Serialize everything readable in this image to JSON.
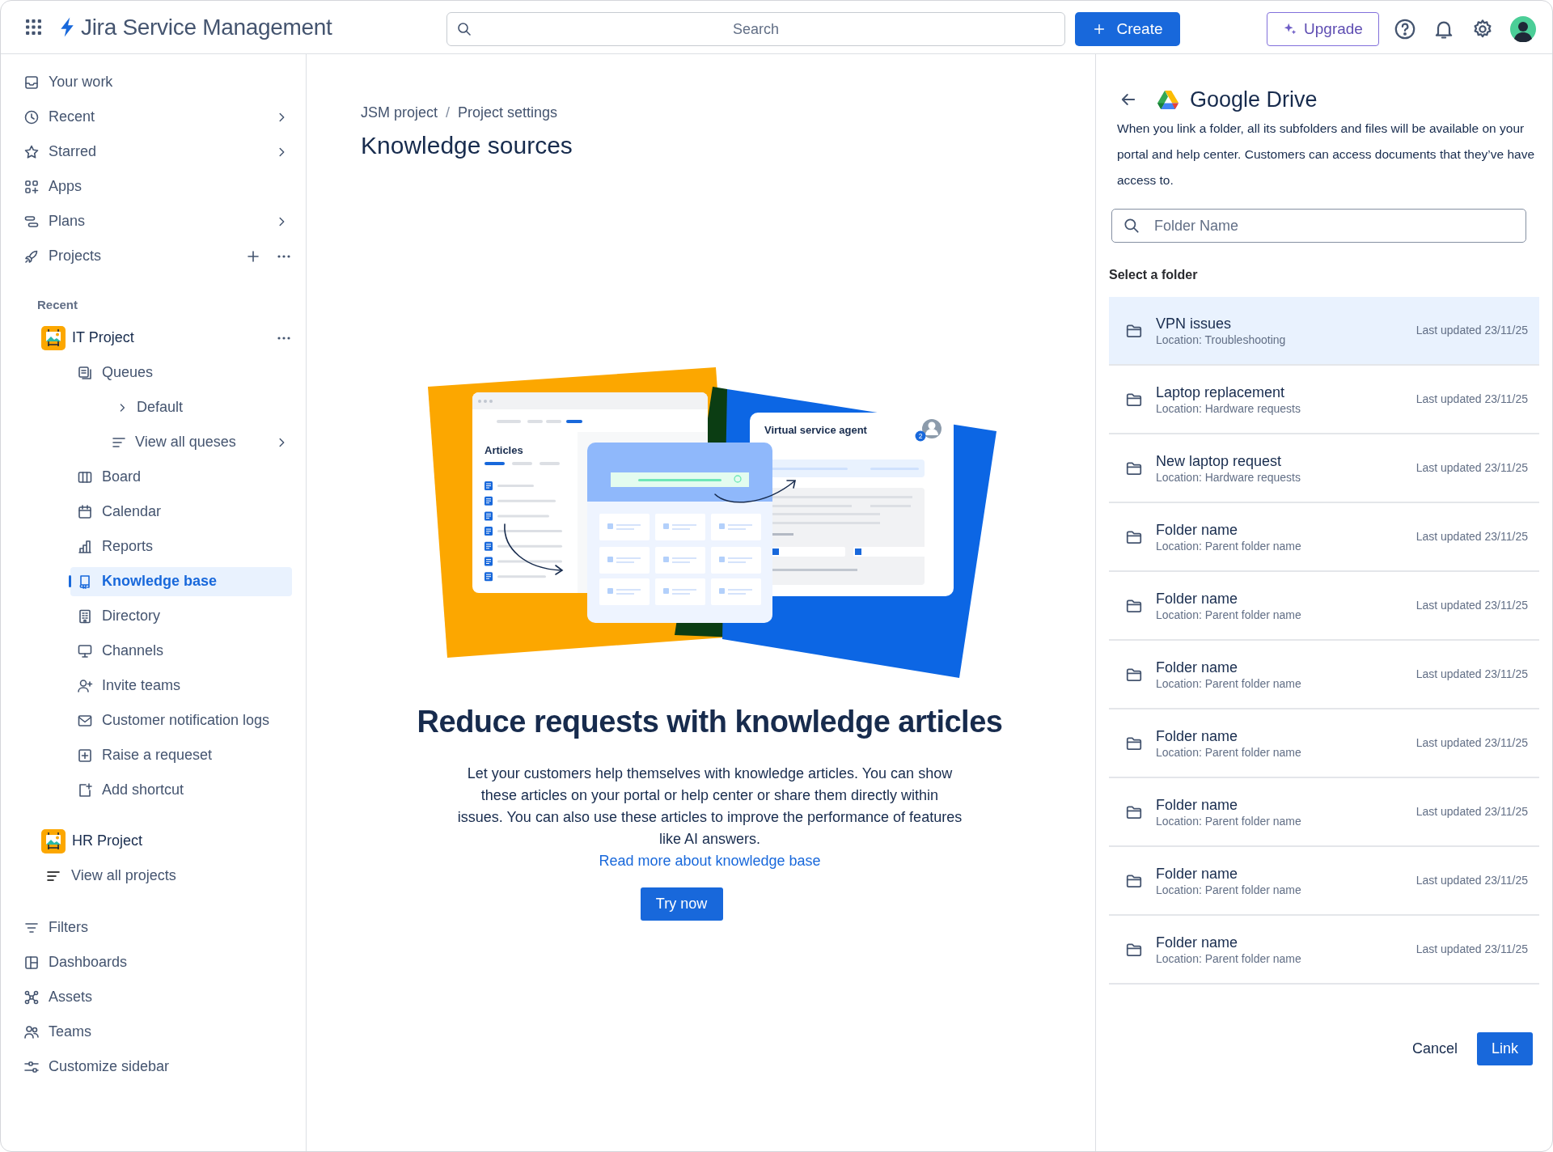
{
  "top_bar": {
    "product": "Jira Service Management",
    "search_placeholder": "Search",
    "create": "Create",
    "upgrade": "Upgrade"
  },
  "sidebar": {
    "nav": [
      {
        "label": "Your work",
        "submenu": false,
        "actions": false,
        "selected": false
      },
      {
        "label": "Recent",
        "submenu": true,
        "actions": false,
        "selected": false
      },
      {
        "label": "Starred",
        "submenu": true,
        "actions": false,
        "selected": false
      },
      {
        "label": "Apps",
        "submenu": false,
        "actions": false,
        "selected": false
      },
      {
        "label": "Plans",
        "submenu": true,
        "actions": false,
        "selected": false
      },
      {
        "label": "Projects",
        "submenu": false,
        "actions": true,
        "selected": false
      }
    ],
    "recent_heading": "Recent",
    "projects": [
      {
        "name": "IT Project",
        "actions": true,
        "children": [
          {
            "label": "Queues",
            "selected": false,
            "children": [
              {
                "label": "Default",
                "expanded": false,
                "submenu": false,
                "selected": false
              },
              {
                "label": "View all queses",
                "submenu": true,
                "selected": false
              }
            ]
          },
          {
            "label": "Board",
            "selected": false
          },
          {
            "label": "Calendar",
            "selected": false
          },
          {
            "label": "Reports",
            "selected": false
          },
          {
            "label": "Knowledge base",
            "selected": true
          },
          {
            "label": "Directory",
            "selected": false
          },
          {
            "label": "Channels",
            "selected": false
          },
          {
            "label": "Invite teams",
            "selected": false
          },
          {
            "label": "Customer notification logs",
            "selected": false
          },
          {
            "label": "Raise a requeset",
            "selected": false
          },
          {
            "label": "Add shortcut",
            "selected": false
          }
        ]
      },
      {
        "name": "HR Project",
        "actions": false
      }
    ],
    "view_all_projects": "View all projects",
    "bottom": [
      {
        "label": "Filters",
        "selected": false
      },
      {
        "label": "Dashboards",
        "selected": false
      },
      {
        "label": "Assets",
        "selected": false
      },
      {
        "label": "Teams",
        "selected": false
      },
      {
        "label": "Customize sidebar",
        "selected": false
      }
    ]
  },
  "main": {
    "breadcrumbs": [
      "JSM project",
      "Project settings"
    ],
    "breadcrumb_separator": "/",
    "title": "Knowledge sources",
    "illustration": {
      "articles_title": "Articles",
      "agent_title": "Virtual service agent",
      "agent_badge": "2"
    },
    "heading": "Reduce requests with knowledge articles",
    "body": "Let your customers help themselves with knowledge articles. You can show these articles on your portal or help center or share them directly within issues. You can also use these articles to improve the performance of features like AI answers.",
    "link": "Read more about knowledge base",
    "button": "Try now"
  },
  "panel": {
    "title": "Google Drive",
    "description": "When you link a folder, all its subfolders and files will be available on your portal and help center. Customers can access documents that they’ve have access to.",
    "search_placeholder": "Folder Name",
    "list_heading": "Select a folder",
    "folders": [
      {
        "name": "VPN issues",
        "location": "Location: Troubleshooting",
        "updated": "Last updated 23/11/25",
        "selected": true
      },
      {
        "name": "Laptop replacement",
        "location": "Location: Hardware requests",
        "updated": "Last updated 23/11/25",
        "selected": false
      },
      {
        "name": "New laptop request",
        "location": "Location: Hardware requests",
        "updated": "Last updated 23/11/25",
        "selected": false
      },
      {
        "name": "Folder name",
        "location": "Location: Parent folder name",
        "updated": "Last updated 23/11/25",
        "selected": false
      },
      {
        "name": "Folder name",
        "location": "Location: Parent folder name",
        "updated": "Last updated 23/11/25",
        "selected": false
      },
      {
        "name": "Folder name",
        "location": "Location: Parent folder name",
        "updated": "Last updated 23/11/25",
        "selected": false
      },
      {
        "name": "Folder name",
        "location": "Location: Parent folder name",
        "updated": "Last updated 23/11/25",
        "selected": false
      },
      {
        "name": "Folder name",
        "location": "Location: Parent folder name",
        "updated": "Last updated 23/11/25",
        "selected": false
      },
      {
        "name": "Folder name",
        "location": "Location: Parent folder name",
        "updated": "Last updated 23/11/25",
        "selected": false
      },
      {
        "name": "Folder name",
        "location": "Location: Parent folder name",
        "updated": "Last updated 23/11/25",
        "selected": false
      }
    ],
    "cancel": "Cancel",
    "link": "Link"
  }
}
